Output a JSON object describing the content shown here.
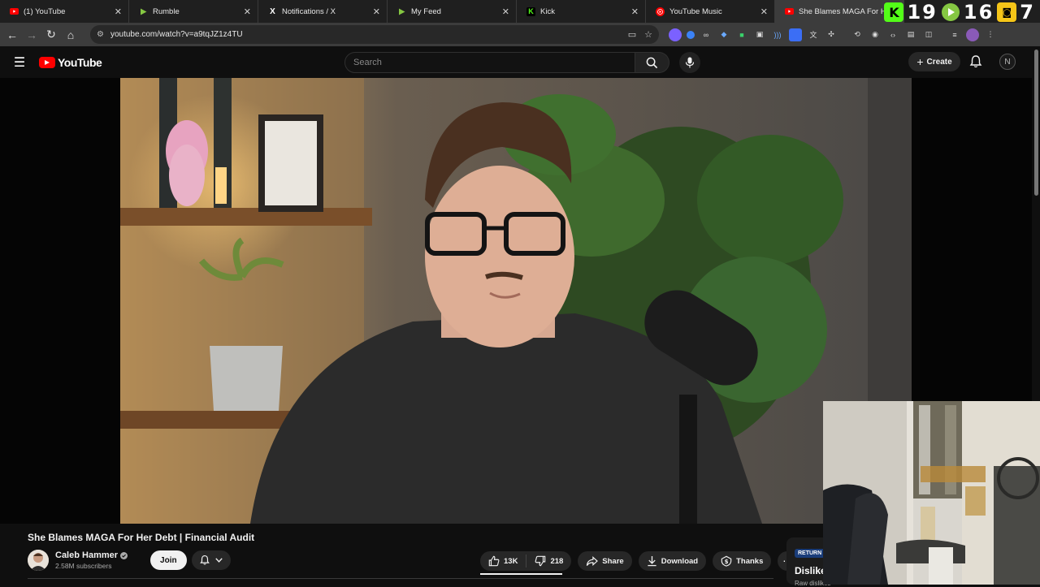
{
  "tabs": [
    {
      "title": "(1) YouTube",
      "icon": "youtube-favicon",
      "active": false
    },
    {
      "title": "Rumble",
      "icon": "rumble-favicon",
      "active": false
    },
    {
      "title": "Notifications / X",
      "icon": "x-favicon",
      "active": false
    },
    {
      "title": "My Feed",
      "icon": "rumble-favicon",
      "active": false
    },
    {
      "title": "Kick",
      "icon": "kick-favicon",
      "active": false
    },
    {
      "title": "YouTube Music",
      "icon": "youtube-music-favicon",
      "active": false
    },
    {
      "title": "She Blames MAGA For Her Debt",
      "icon": "youtube-favicon",
      "active": true
    }
  ],
  "overlay": {
    "kick_count": "19",
    "rumble_count": "16",
    "third_count": "7"
  },
  "address_bar": {
    "url": "youtube.com/watch?v=a9tqJZ1z4TU"
  },
  "header": {
    "logo_text": "YouTube",
    "search_placeholder": "Search",
    "create_label": "Create",
    "avatar_initial": "N"
  },
  "video": {
    "title": "She Blames MAGA For Her Debt | Financial Audit",
    "channel_name": "Caleb Hammer",
    "subscribers": "2.58M subscribers",
    "join_label": "Join",
    "likes": "13K",
    "dislikes": "218",
    "share_label": "Share",
    "download_label": "Download",
    "thanks_label": "Thanks"
  },
  "sidebar_card": {
    "badge": "RETURN",
    "title": "Dislikes",
    "subtitle": "Raw dislikes"
  },
  "colors": {
    "brand_red": "#ff0000",
    "bg": "#0f0f0f",
    "pill": "#272727",
    "kick_green": "#53fc18",
    "rumble_green": "#85c742"
  }
}
